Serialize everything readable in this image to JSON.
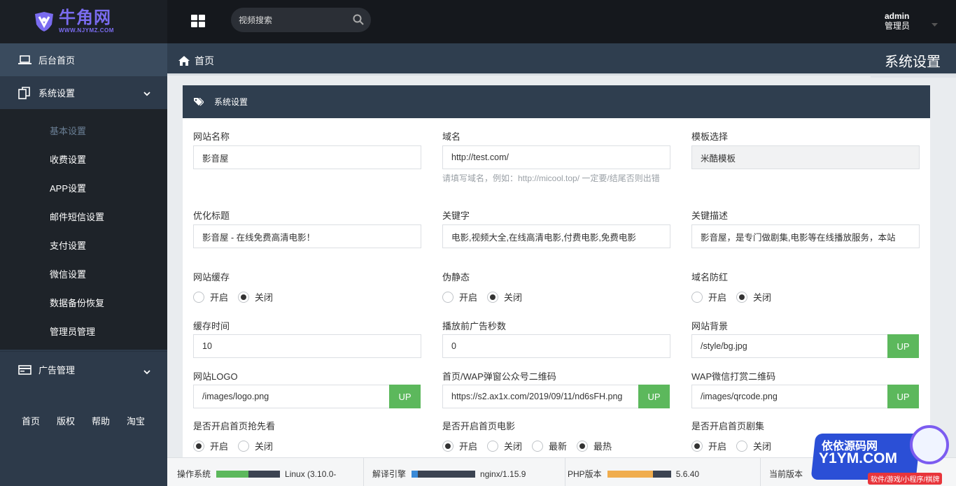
{
  "logo": {
    "cn": "牛角网",
    "en": "WWW.NJYMZ.COM"
  },
  "sidebar": {
    "home": "后台首页",
    "settings_group": "系统设置",
    "sub_items": [
      {
        "label": "基本设置",
        "active": true
      },
      {
        "label": "收费设置"
      },
      {
        "label": "APP设置"
      },
      {
        "label": "邮件短信设置"
      },
      {
        "label": "支付设置"
      },
      {
        "label": "微信设置"
      },
      {
        "label": "数据备份恢复"
      },
      {
        "label": "管理员管理"
      }
    ],
    "ad_group": "广告管理",
    "bottom_links": [
      "首页",
      "版权",
      "帮助",
      "淘宝"
    ]
  },
  "topbar": {
    "search_placeholder": "视频搜索",
    "user_name": "admin",
    "user_role": "管理员"
  },
  "breadcrumb": {
    "home": "首页",
    "page_title": "系统设置"
  },
  "card": {
    "title": "系统设置",
    "fields": {
      "site_name": {
        "label": "网站名称",
        "value": "影音屋"
      },
      "domain": {
        "label": "域名",
        "value": "http://test.com/",
        "help": "请填写域名，例如：http://micool.top/ 一定要/结尾否则出错"
      },
      "template": {
        "label": "模板选择",
        "value": "米酷模板"
      },
      "seo_title": {
        "label": "优化标题",
        "value": "影音屋 - 在线免费高清电影！"
      },
      "keywords": {
        "label": "关键字",
        "value": "电影,视频大全,在线高清电影,付费电影,免费电影"
      },
      "description": {
        "label": "关键描述",
        "value": "影音屋，是专门做剧集,电影等在线播放服务，本站"
      },
      "cache": {
        "label": "网站缓存",
        "options": [
          "开启",
          "关闭"
        ],
        "selected": "关闭"
      },
      "pseudo_static": {
        "label": "伪静态",
        "options": [
          "开启",
          "关闭"
        ],
        "selected": "关闭"
      },
      "domain_guard": {
        "label": "域名防红",
        "options": [
          "开启",
          "关闭"
        ],
        "selected": "关闭"
      },
      "cache_time": {
        "label": "缓存时间",
        "value": "10"
      },
      "preroll_seconds": {
        "label": "播放前广告秒数",
        "value": "0"
      },
      "site_bg": {
        "label": "网站背景",
        "value": "/style/bg.jpg",
        "button": "UP"
      },
      "site_logo": {
        "label": "网站LOGO",
        "value": "/images/logo.png",
        "button": "UP"
      },
      "popup_qr": {
        "label": "首页/WAP弹窗公众号二维码",
        "value": "https://s2.ax1x.com/2019/09/11/nd6sFH.png",
        "button": "UP"
      },
      "wap_reward_qr": {
        "label": "WAP微信打赏二维码",
        "value": "/images/qrcode.png",
        "button": "UP"
      },
      "home_preview": {
        "label": "是否开启首页抢先看",
        "options": [
          "开启",
          "关闭"
        ],
        "selected": "开启"
      },
      "home_movies": {
        "label": "是否开启首页电影",
        "options": [
          "开启",
          "关闭",
          "最新",
          "最热"
        ],
        "selected": [
          "开启",
          "最热"
        ]
      },
      "home_series": {
        "label": "是否开启首页剧集",
        "options": [
          "开启",
          "关闭"
        ],
        "selected": "开启"
      }
    }
  },
  "statusbar": {
    "os": {
      "label": "操作系统",
      "value": "Linux (3.10.0-",
      "fill": 0.5,
      "color": "#5cb85c"
    },
    "engine": {
      "label": "解译引擎",
      "value": "nginx/1.15.9",
      "fill": 0.1,
      "color": "#3a8ad8"
    },
    "php": {
      "label": "PHP版本",
      "value": "5.6.40",
      "fill": 0.72,
      "color": "#f0ad4e"
    },
    "current": {
      "label": "当前版本"
    }
  },
  "watermark": {
    "line1": "依依源码网",
    "line2": "Y1YM.COM",
    "line3": "软件/游戏/小程序/棋牌"
  },
  "colors": {
    "sidebar": "#2d3a4a",
    "topbar": "#15181d",
    "accent_green": "#5cb85c",
    "logo": "#7a6cf0"
  }
}
